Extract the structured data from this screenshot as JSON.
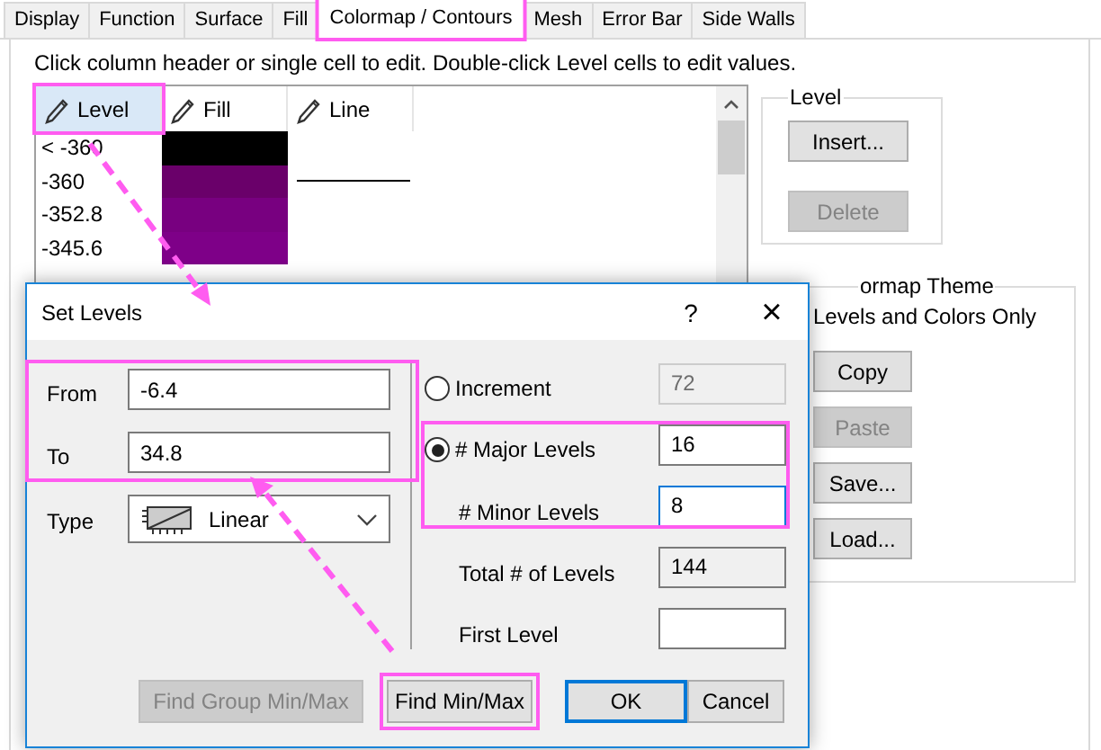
{
  "tabs": [
    {
      "label": "Display",
      "selected": false
    },
    {
      "label": "Function",
      "selected": false
    },
    {
      "label": "Surface",
      "selected": false
    },
    {
      "label": "Fill",
      "selected": false
    },
    {
      "label": "Colormap / Contours",
      "selected": true
    },
    {
      "label": "Mesh",
      "selected": false
    },
    {
      "label": "Error Bar",
      "selected": false
    },
    {
      "label": "Side Walls",
      "selected": false
    }
  ],
  "instruction": "Click column header or single cell to edit. Double-click Level cells to edit values.",
  "table": {
    "columns": [
      {
        "label": "Level",
        "selected": true
      },
      {
        "label": "Fill",
        "selected": false
      },
      {
        "label": "Line",
        "selected": false
      }
    ],
    "rows": [
      {
        "level": "< -360",
        "color": "#000000",
        "line": false
      },
      {
        "level": "-360",
        "color": "#6a006a",
        "line": true
      },
      {
        "level": "-352.8",
        "color": "#780080",
        "line": false
      },
      {
        "level": "-345.6",
        "color": "#7e0088",
        "line": false
      }
    ]
  },
  "level_group": {
    "title": "Level",
    "buttons": [
      {
        "label": "Insert...",
        "disabled": false
      },
      {
        "label": "Delete",
        "disabled": true
      }
    ]
  },
  "theme_group": {
    "title": "ormap Theme",
    "option": "Levels and Colors Only",
    "buttons": [
      {
        "label": "Copy",
        "disabled": false
      },
      {
        "label": "Paste",
        "disabled": true
      },
      {
        "label": "Save...",
        "disabled": false
      },
      {
        "label": "Load...",
        "disabled": false
      }
    ]
  },
  "dialog": {
    "title": "Set Levels",
    "help": "?",
    "close": "×",
    "from": {
      "label": "From",
      "value": "-6.4"
    },
    "to": {
      "label": "To",
      "value": "34.8"
    },
    "type": {
      "label": "Type",
      "value": "Linear"
    },
    "increment": {
      "label": "Increment",
      "selected": false,
      "value": "72"
    },
    "major": {
      "label": "# Major Levels",
      "selected": true,
      "value": "16"
    },
    "minor": {
      "label": "# Minor Levels",
      "value": "8",
      "focused": true
    },
    "total": {
      "label": "Total # of Levels",
      "value": "144"
    },
    "first_level": {
      "label": "First Level"
    },
    "buttons": [
      {
        "label": "Find Group Min/Max",
        "disabled": true,
        "default": false
      },
      {
        "label": "Find Min/Max",
        "disabled": false,
        "default": false
      },
      {
        "label": "OK",
        "disabled": false,
        "default": true
      },
      {
        "label": "Cancel",
        "disabled": false,
        "default": false
      }
    ]
  }
}
